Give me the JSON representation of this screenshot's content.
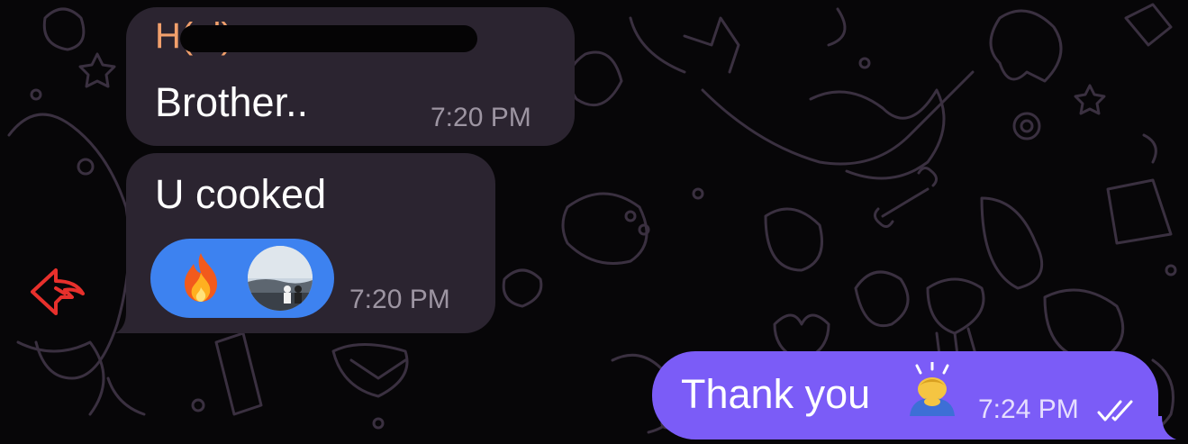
{
  "colors": {
    "background": "#070608",
    "incoming_bubble": "#2b2430",
    "outgoing_bubble": "#7b5cf7",
    "sender_name": "#f2a06c",
    "reaction_pill": "#3d82f0",
    "time_incoming": "#9d95a2",
    "time_outgoing": "#e6defe",
    "doodles": "#3a3040",
    "reply_arrow": "#e8302c"
  },
  "messages": [
    {
      "sender": "H(al)",
      "sender_redacted": true,
      "text": "Brother..",
      "time": "7:20 PM"
    },
    {
      "text": "U cooked",
      "time": "7:20 PM",
      "reactions": [
        {
          "emoji": "🔥",
          "icon": "fire-icon"
        },
        {
          "icon": "reactor-avatar"
        }
      ]
    },
    {
      "text": "Thank you",
      "emoji_icon": "person-bowing-emoji",
      "time": "7:24 PM",
      "status_icon": "double-check-icon"
    }
  ],
  "reply_icon": "reply-arrow-icon"
}
